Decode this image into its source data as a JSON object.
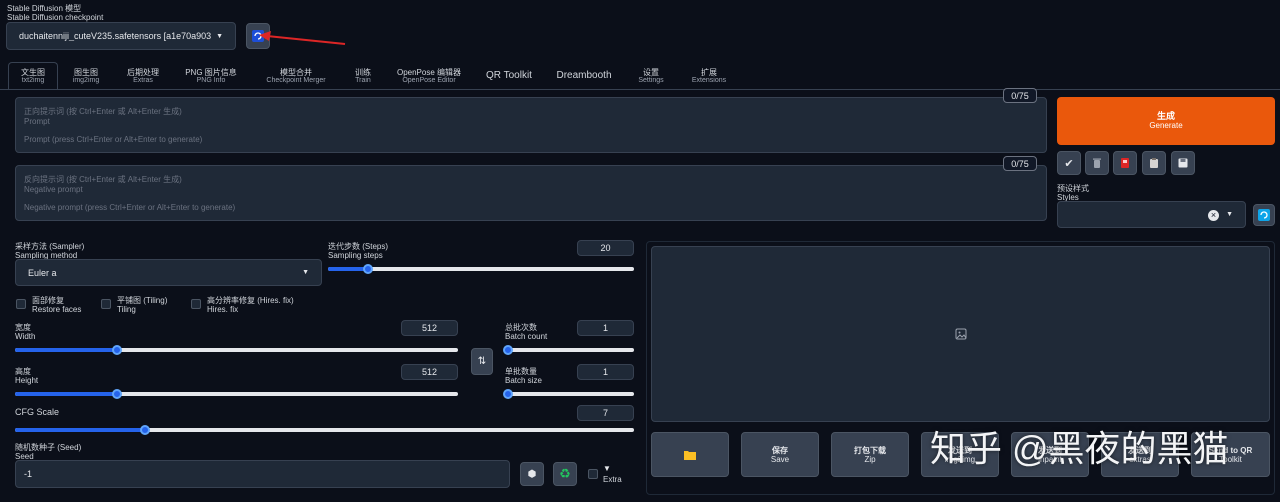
{
  "checkpoint": {
    "label_cn": "Stable Diffusion 模型",
    "label_en": "Stable Diffusion checkpoint",
    "value": "duchaitenniji_cuteV235.safetensors [a1e70a903"
  },
  "tabs": [
    {
      "cn": "文生图",
      "en": "txt2img"
    },
    {
      "cn": "图生图",
      "en": "img2img"
    },
    {
      "cn": "后期处理",
      "en": "Extras"
    },
    {
      "cn": "PNG 图片信息",
      "en": "PNG Info"
    },
    {
      "cn": "模型合并",
      "en": "Checkpoint Merger"
    },
    {
      "cn": "训练",
      "en": "Train"
    },
    {
      "cn": "OpenPose 编辑器",
      "en": "OpenPose Editor"
    },
    {
      "cn": "QR Toolkit",
      "en": ""
    },
    {
      "cn": "Dreambooth",
      "en": ""
    },
    {
      "cn": "设置",
      "en": "Settings"
    },
    {
      "cn": "扩展",
      "en": "Extensions"
    }
  ],
  "prompt": {
    "counter": "0/75",
    "line1": "正向提示词 (按 Ctrl+Enter 或 Alt+Enter 生成)",
    "line2": "Prompt",
    "line3": "Prompt (press Ctrl+Enter or Alt+Enter to generate)"
  },
  "negative": {
    "counter": "0/75",
    "line1": "反向提示词 (按 Ctrl+Enter 或 Alt+Enter 生成)",
    "line2": "Negative prompt",
    "line3": "Negative prompt (press Ctrl+Enter or Alt+Enter to generate)"
  },
  "generate": {
    "cn": "生成",
    "en": "Generate",
    "color": "#ea580c"
  },
  "tool_icons": [
    "check-icon",
    "trash-icon",
    "red-card-icon",
    "clipboard-icon",
    "save-icon"
  ],
  "styles": {
    "cn": "预设样式",
    "en": "Styles",
    "clear": "×"
  },
  "sampler": {
    "cn": "采样方法 (Sampler)",
    "en": "Sampling method",
    "value": "Euler a"
  },
  "steps": {
    "cn": "迭代步数 (Steps)",
    "en": "Sampling steps",
    "value": "20",
    "fraction": 0.13
  },
  "restore_faces": {
    "cn": "面部修复",
    "en": "Restore faces"
  },
  "tiling": {
    "cn": "平铺图 (Tiling)",
    "en": "Tiling"
  },
  "hires": {
    "cn": "高分辨率修复 (Hires. fix)",
    "en": "Hires. fix"
  },
  "width": {
    "cn": "宽度",
    "en": "Width",
    "value": "512",
    "fraction": 0.23
  },
  "height": {
    "cn": "高度",
    "en": "Height",
    "value": "512",
    "fraction": 0.23
  },
  "batch_count": {
    "cn": "总批次数",
    "en": "Batch count",
    "value": "1",
    "fraction": 0.0
  },
  "batch_size": {
    "cn": "单批数量",
    "en": "Batch size",
    "value": "1",
    "fraction": 0.0
  },
  "cfg": {
    "label": "CFG Scale",
    "value": "7",
    "fraction": 0.21
  },
  "seed": {
    "cn": "随机数种子 (Seed)",
    "en": "Seed",
    "value": "-1"
  },
  "extra": {
    "arrow": "▼",
    "label": "Extra"
  },
  "bottom_buttons": [
    {
      "cn": "",
      "en": ""
    },
    {
      "cn": "保存",
      "en": "Save"
    },
    {
      "cn": "打包下载",
      "en": "Zip"
    },
    {
      "cn": "发送到",
      "en": "img2img"
    },
    {
      "cn": "发送到",
      "en": "inpaint"
    },
    {
      "cn": "发送到",
      "en": "extras"
    },
    {
      "cn": "Send to QR",
      "en": "Toolkit"
    }
  ],
  "watermark": "知乎 @黑夜的黑猫"
}
